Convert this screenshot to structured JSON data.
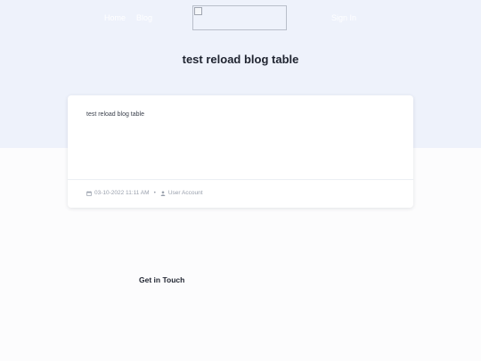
{
  "nav": {
    "home_label": "Home",
    "blog_label": "Blog",
    "right_label": "Sign In"
  },
  "logo": {
    "alt": ""
  },
  "page": {
    "title": "test reload blog table"
  },
  "post": {
    "excerpt": "test reload blog table",
    "date": "03-10-2022 11:11 AM",
    "separator": "•",
    "author": "User Account"
  },
  "footer": {
    "get_in_touch": "Get in Touch"
  },
  "colors": {
    "hero_background": "#eef2fb",
    "page_background": "#fcfcfd",
    "title_text": "#1f2430",
    "meta_text": "#9aa1ad"
  }
}
